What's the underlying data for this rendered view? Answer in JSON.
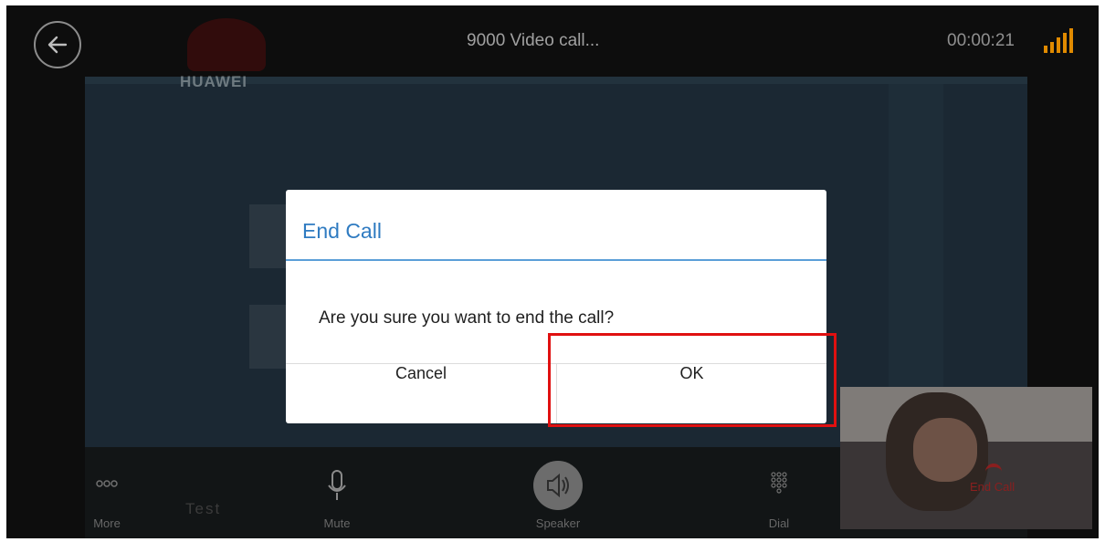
{
  "header": {
    "call_title": "9000  Video call...",
    "timer": "00:00:21",
    "back_icon": "arrow-left-icon",
    "signal_icon": "signal-strength-icon"
  },
  "video": {
    "logo_text": "HUAWEI",
    "overlay_text": "Test"
  },
  "controls": [
    {
      "label": "More",
      "icon": "more-icon"
    },
    {
      "label": "Mute",
      "icon": "microphone-icon"
    },
    {
      "label": "Speaker",
      "icon": "speaker-icon"
    },
    {
      "label": "Dial",
      "icon": "dialpad-icon"
    },
    {
      "label": "End Call",
      "icon": "hangup-icon"
    }
  ],
  "dialog": {
    "title": "End Call",
    "message": "Are you sure you want to end the call?",
    "cancel_label": "Cancel",
    "ok_label": "OK"
  },
  "colors": {
    "accent": "#2f7bc1",
    "highlight": "#e01010",
    "signal": "#e08a00"
  }
}
